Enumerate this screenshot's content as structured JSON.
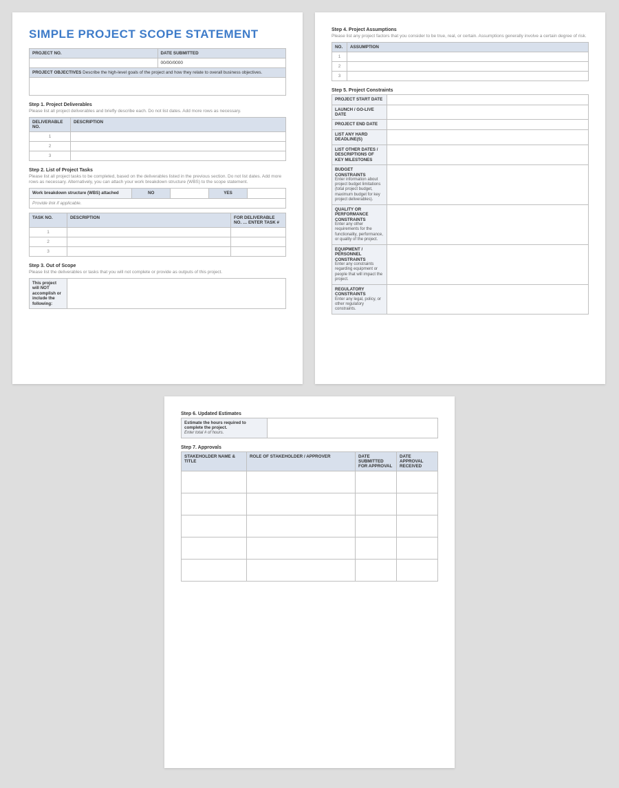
{
  "title": "SIMPLE PROJECT SCOPE STATEMENT",
  "header": {
    "projectNoLabel": "PROJECT NO.",
    "dateSubmittedLabel": "DATE SUBMITTED",
    "dateSubmittedValue": "00/00/0000",
    "objectivesLabel": "PROJECT OBJECTIVES",
    "objectivesHint": "Describe the high-level goals of the project and how they relate to overall business objectives."
  },
  "step1": {
    "title": "Step 1. Project Deliverables",
    "desc": "Please list all project deliverables and briefly describe each. Do not list dates. Add more rows as necessary.",
    "colDelivNo": "DELIVERABLE NO.",
    "colDesc": "DESCRIPTION",
    "rows": [
      "1",
      "2",
      "3"
    ]
  },
  "step2": {
    "title": "Step 2. List of Project Tasks",
    "desc": "Please list all project tasks to be completed, based on the deliverables listed in the previous section. Do not list dates. Add more rows as necessary. Alternatively, you can attach your work breakdown structure (WBS) to the scope statement.",
    "wbsAttached": "Work breakdown structure (WBS) attached",
    "no": "NO",
    "yes": "YES",
    "provideLink": "Provide link if applicable.",
    "colTaskNo": "TASK NO.",
    "colDesc": "DESCRIPTION",
    "colForDeliv": "FOR DELIVERABLE NO. … ENTER TASK #",
    "rows": [
      "1",
      "2",
      "3"
    ]
  },
  "step3": {
    "title": "Step 3. Out of Scope",
    "desc": "Please list the deliverables or tasks that you will not complete or provide as outputs of this project.",
    "label_pre": "This project ",
    "label_bold1": "will NOT accomplish or include",
    "label_post": " the following:"
  },
  "step4": {
    "title": "Step 4. Project Assumptions",
    "desc": "Please list any project factors that you consider to be true, real, or certain. Assumptions generally involve a certain degree of risk.",
    "colNo": "NO.",
    "colAssumption": "ASSUMPTION",
    "rows": [
      "1",
      "2",
      "3"
    ]
  },
  "step5": {
    "title": "Step 5. Project Constraints",
    "rows": {
      "start": "PROJECT START DATE",
      "launch": "LAUNCH / GO-LIVE DATE",
      "end": "PROJECT END DATE",
      "hard": "LIST ANY HARD DEADLINE(S)",
      "other": "LIST OTHER DATES / DESCRIPTIONS OF KEY MILESTONES",
      "budget": "BUDGET CONSTRAINTS",
      "budgetSub": "Enter information about project budget limitations (total project budget, maximum budget for key project deliverables).",
      "quality": "QUALITY OR PERFORMANCE CONSTRAINTS",
      "qualitySub": "Enter any other requirements for the functionality, performance, or quality of the project.",
      "equip": "EQUIPMENT / PERSONNEL CONSTRAINTS",
      "equipSub": "Enter any constraints regarding equipment or people that will impact the project.",
      "reg": "REGULATORY CONSTRAINTS",
      "regSub": "Enter any legal, policy, or other regulatory constraints."
    }
  },
  "step6": {
    "title": "Step 6. Updated Estimates",
    "label": "Estimate the hours required to complete the project.",
    "hint": "Enter total # of hours."
  },
  "step7": {
    "title": "Step 7. Approvals",
    "colName": "STAKEHOLDER NAME & TITLE",
    "colRole": "ROLE OF STAKEHOLDER / APPROVER",
    "colSubmitted": "DATE SUBMITTED FOR APPROVAL",
    "colReceived": "DATE APPROVAL RECEIVED"
  }
}
